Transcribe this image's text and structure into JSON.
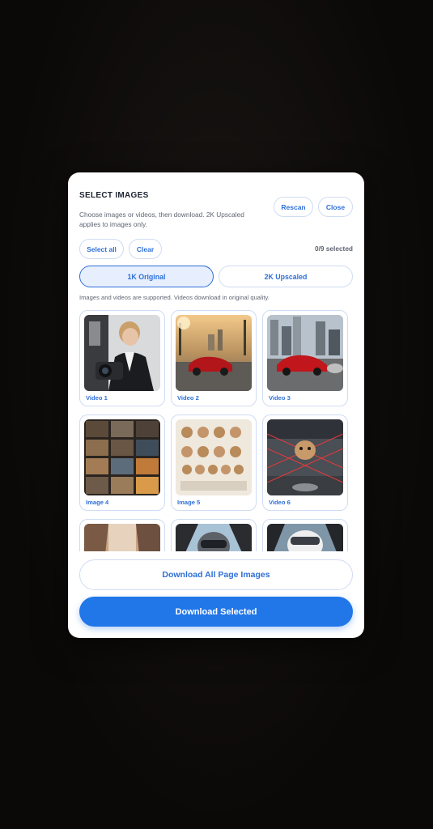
{
  "modal": {
    "title": "SELECT IMAGES",
    "description": "Choose images or videos, then download. 2K Upscaled applies to images only.",
    "rescan_label": "Rescan",
    "close_label": "Close",
    "select_all_label": "Select all",
    "clear_label": "Clear",
    "selection_count": "0/9 selected",
    "quality_options": [
      {
        "label": "1K Original",
        "selected": true
      },
      {
        "label": "2K Upscaled",
        "selected": false
      }
    ],
    "note": "Images and videos are supported. Videos download in original quality.",
    "items": [
      {
        "label": "Video 1",
        "icon": "photographer-with-camera"
      },
      {
        "label": "Video 2",
        "icon": "red-sports-car-sunset-street"
      },
      {
        "label": "Video 3",
        "icon": "red-sports-car-city"
      },
      {
        "label": "Image 4",
        "icon": "collage-grid"
      },
      {
        "label": "Image 5",
        "icon": "character-sheet"
      },
      {
        "label": "Video 6",
        "icon": "hamster-laser-room"
      },
      {
        "label": "",
        "icon": "canyon-landscape"
      },
      {
        "label": "",
        "icon": "pilot-cockpit"
      },
      {
        "label": "",
        "icon": "pilot-cockpit-helmet"
      }
    ],
    "download_all_label": "Download All Page Images",
    "download_selected_label": "Download Selected"
  },
  "colors": {
    "accent": "#2176e8",
    "accent_text": "#2f6fd6",
    "border": "#cfdcf2",
    "selected_bg": "#e7efff"
  }
}
